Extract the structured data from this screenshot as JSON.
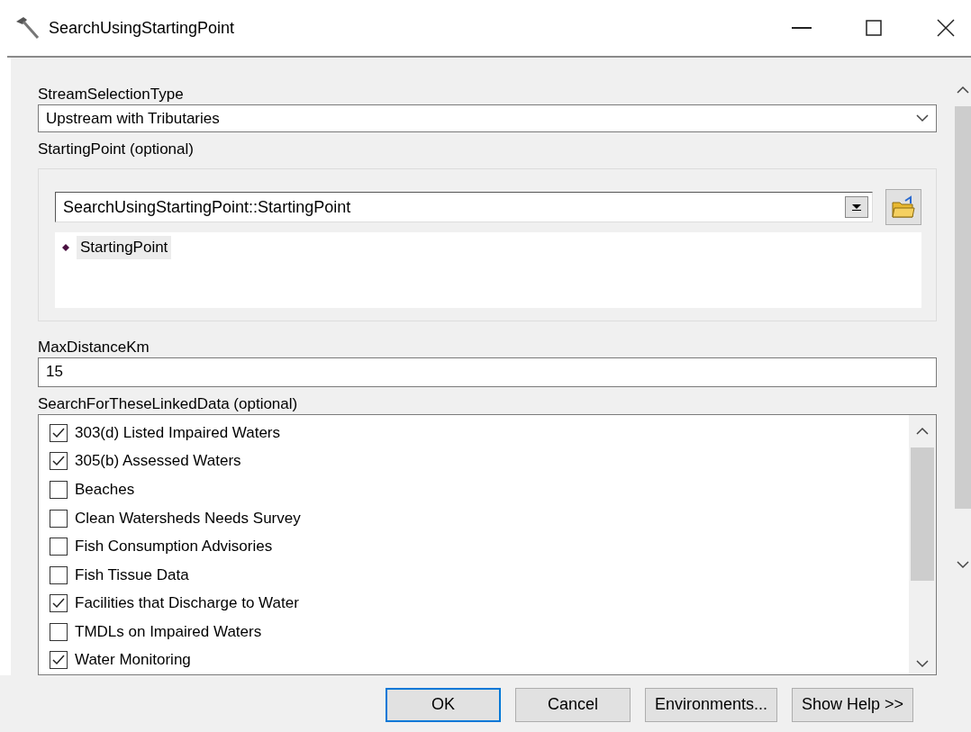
{
  "window": {
    "title": "SearchUsingStartingPoint"
  },
  "stream_selection_type": {
    "label": "StreamSelectionType",
    "value": "Upstream with Tributaries"
  },
  "starting_point": {
    "label": "StartingPoint (optional)",
    "value": "SearchUsingStartingPoint::StartingPoint",
    "items": [
      {
        "label": "StartingPoint",
        "selected": true
      }
    ]
  },
  "max_distance_km": {
    "label": "MaxDistanceKm",
    "value": "15"
  },
  "linked_data": {
    "label": "SearchForTheseLinkedData (optional)",
    "items": [
      {
        "label": "303(d) Listed Impaired Waters",
        "checked": true
      },
      {
        "label": "305(b) Assessed Waters",
        "checked": true
      },
      {
        "label": "Beaches",
        "checked": false
      },
      {
        "label": "Clean Watersheds Needs Survey",
        "checked": false
      },
      {
        "label": "Fish Consumption Advisories",
        "checked": false
      },
      {
        "label": "Fish Tissue Data",
        "checked": false
      },
      {
        "label": "Facilities that Discharge to Water",
        "checked": true
      },
      {
        "label": "TMDLs on Impaired Waters",
        "checked": false
      },
      {
        "label": "Water Monitoring",
        "checked": true
      }
    ]
  },
  "buttons": [
    {
      "label": "OK",
      "selected": true
    },
    {
      "label": "Cancel",
      "selected": false
    },
    {
      "label": "Environments...",
      "selected": false
    },
    {
      "label": "Show Help >>",
      "selected": false
    }
  ]
}
